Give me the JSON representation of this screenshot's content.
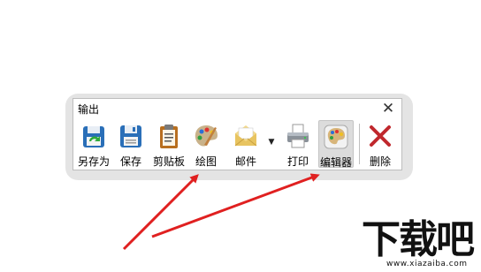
{
  "dialog": {
    "title": "输出",
    "close_glyph": "✕"
  },
  "toolbar": {
    "buttons": [
      {
        "label": "另存为",
        "icon": "save-as-icon",
        "pressed": false
      },
      {
        "label": "保存",
        "icon": "floppy-disk-icon",
        "pressed": false
      },
      {
        "label": "剪贴板",
        "icon": "clipboard-icon",
        "pressed": false
      },
      {
        "label": "绘图",
        "icon": "paint-palette-icon",
        "pressed": false
      },
      {
        "label": "邮件",
        "icon": "envelope-icon",
        "pressed": false
      },
      {
        "label": "打印",
        "icon": "printer-icon",
        "pressed": false
      },
      {
        "label": "编辑器",
        "icon": "editor-palette-icon",
        "pressed": true
      },
      {
        "label": "删除",
        "icon": "delete-x-icon",
        "pressed": false
      }
    ],
    "mail_dropdown_glyph": "▼"
  },
  "colors": {
    "arrow": "#e02020",
    "delete_x": "#c0282d",
    "pressed_bg": "#dcdcdc"
  },
  "watermark": {
    "text": "下载吧",
    "url": "www.xiazaiba.com"
  }
}
